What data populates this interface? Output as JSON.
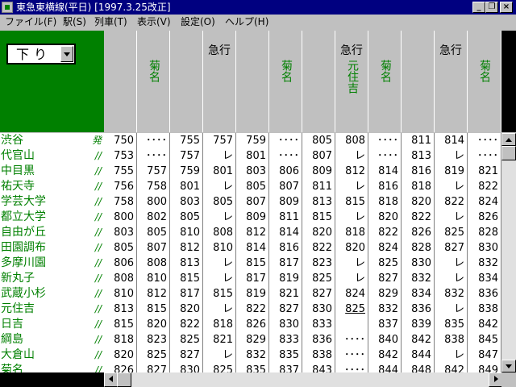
{
  "window": {
    "title": "東急東横線(平日) [1997.3.25改正]"
  },
  "menu": [
    {
      "label": "ファイル(F)"
    },
    {
      "label": "駅(S)"
    },
    {
      "label": "列車(T)"
    },
    {
      "label": "表示(V)"
    },
    {
      "label": "設定(O)"
    },
    {
      "label": "ヘルプ(H)"
    }
  ],
  "direction": {
    "selected": "下り"
  },
  "columns": [
    {
      "type": "",
      "dest": ""
    },
    {
      "type": "",
      "dest": "菊名"
    },
    {
      "type": "",
      "dest": ""
    },
    {
      "type": "急行",
      "dest": ""
    },
    {
      "type": "",
      "dest": ""
    },
    {
      "type": "",
      "dest": "菊名"
    },
    {
      "type": "",
      "dest": ""
    },
    {
      "type": "急行",
      "dest": "元住吉"
    },
    {
      "type": "",
      "dest": "菊名"
    },
    {
      "type": "",
      "dest": ""
    },
    {
      "type": "急行",
      "dest": ""
    },
    {
      "type": "",
      "dest": "菊名"
    }
  ],
  "stations": [
    {
      "name": "渋谷",
      "mark": "発"
    },
    {
      "name": "代官山",
      "mark": "//"
    },
    {
      "name": "中目黒",
      "mark": "//"
    },
    {
      "name": "祐天寺",
      "mark": "//"
    },
    {
      "name": "学芸大学",
      "mark": "//"
    },
    {
      "name": "都立大学",
      "mark": "//"
    },
    {
      "name": "自由が丘",
      "mark": "//"
    },
    {
      "name": "田園調布",
      "mark": "//"
    },
    {
      "name": "多摩川園",
      "mark": "//"
    },
    {
      "name": "新丸子",
      "mark": "//"
    },
    {
      "name": "武蔵小杉",
      "mark": "//"
    },
    {
      "name": "元住吉",
      "mark": "//"
    },
    {
      "name": "日吉",
      "mark": "//"
    },
    {
      "name": "綱島",
      "mark": "//"
    },
    {
      "name": "大倉山",
      "mark": "//"
    },
    {
      "name": "菊名",
      "mark": "//"
    }
  ],
  "times": [
    [
      "750",
      "････",
      "755",
      "757",
      "759",
      "････",
      "805",
      "808",
      "････",
      "811",
      "814",
      "････"
    ],
    [
      "753",
      "････",
      "757",
      "レ",
      "801",
      "････",
      "807",
      "レ",
      "････",
      "813",
      "レ",
      "････"
    ],
    [
      "755",
      "757",
      "759",
      "801",
      "803",
      "806",
      "809",
      "812",
      "814",
      "816",
      "819",
      "821"
    ],
    [
      "756",
      "758",
      "801",
      "レ",
      "805",
      "807",
      "811",
      "レ",
      "816",
      "818",
      "レ",
      "822"
    ],
    [
      "758",
      "800",
      "803",
      "805",
      "807",
      "809",
      "813",
      "815",
      "818",
      "820",
      "822",
      "824"
    ],
    [
      "800",
      "802",
      "805",
      "レ",
      "809",
      "811",
      "815",
      "レ",
      "820",
      "822",
      "レ",
      "826"
    ],
    [
      "803",
      "805",
      "810",
      "808",
      "812",
      "814",
      "820",
      "818",
      "822",
      "826",
      "825",
      "828"
    ],
    [
      "805",
      "807",
      "812",
      "810",
      "814",
      "816",
      "822",
      "820",
      "824",
      "828",
      "827",
      "830"
    ],
    [
      "806",
      "808",
      "813",
      "レ",
      "815",
      "817",
      "823",
      "レ",
      "825",
      "830",
      "レ",
      "832"
    ],
    [
      "808",
      "810",
      "815",
      "レ",
      "817",
      "819",
      "825",
      "レ",
      "827",
      "832",
      "レ",
      "834"
    ],
    [
      "810",
      "812",
      "817",
      "815",
      "819",
      "821",
      "827",
      "824",
      "829",
      "834",
      "832",
      "836"
    ],
    [
      "813",
      "815",
      "820",
      "レ",
      "822",
      "827",
      "830",
      "825",
      "832",
      "836",
      "レ",
      "838"
    ],
    [
      "815",
      "820",
      "822",
      "818",
      "826",
      "830",
      "833",
      "",
      "837",
      "839",
      "835",
      "842"
    ],
    [
      "818",
      "823",
      "825",
      "821",
      "829",
      "833",
      "836",
      "････",
      "840",
      "842",
      "838",
      "845"
    ],
    [
      "820",
      "825",
      "827",
      "レ",
      "832",
      "835",
      "838",
      "････",
      "842",
      "844",
      "レ",
      "847"
    ],
    [
      "826",
      "827",
      "830",
      "825",
      "835",
      "837",
      "843",
      "････",
      "844",
      "848",
      "842",
      "849"
    ]
  ]
}
